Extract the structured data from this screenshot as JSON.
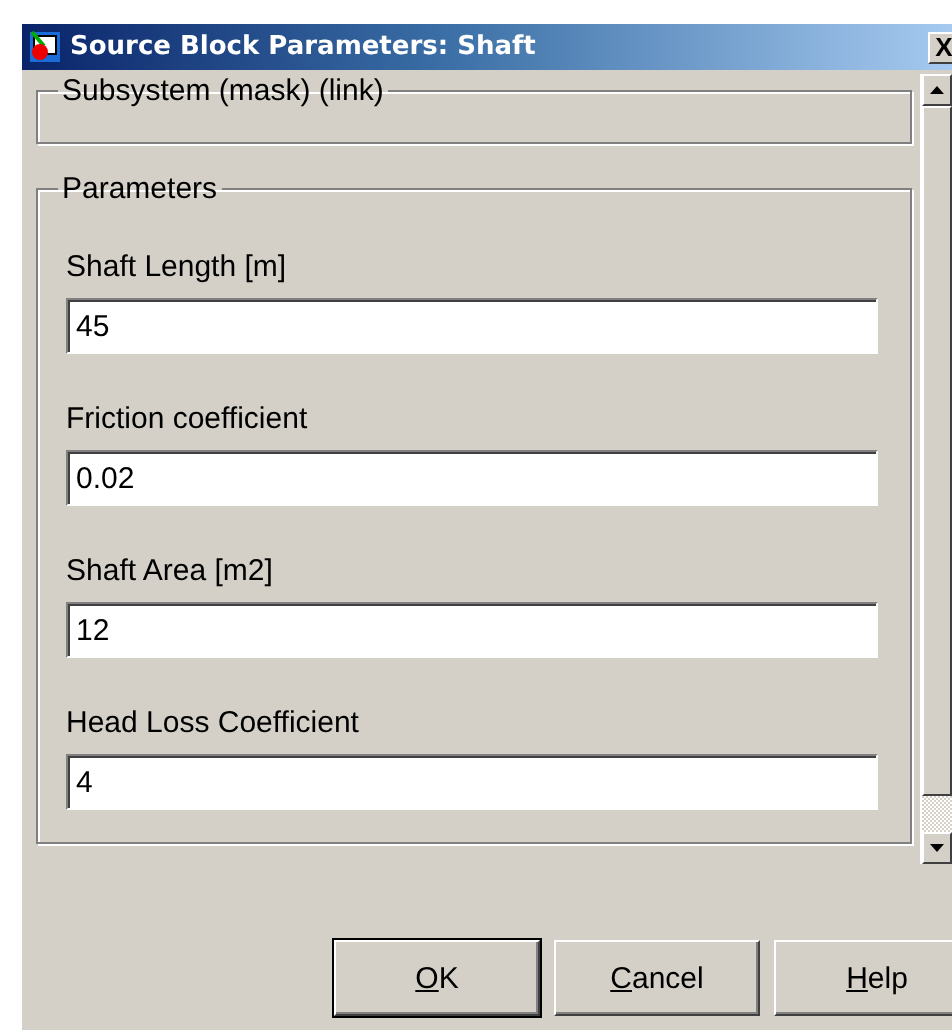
{
  "window": {
    "title": "Source Block Parameters: Shaft",
    "close": "X"
  },
  "description_group": {
    "title": "Subsystem (mask) (link)"
  },
  "parameters_group": {
    "title": "Parameters",
    "fields": [
      {
        "label": "Shaft Length [m]",
        "value": "45"
      },
      {
        "label": "Friction coefficient",
        "value": "0.02"
      },
      {
        "label": "Shaft Area [m2]",
        "value": "12"
      },
      {
        "label": "Head Loss Coefficient",
        "value": "4"
      }
    ]
  },
  "buttons": [
    {
      "label": "OK",
      "default": true
    },
    {
      "label": "Cancel",
      "default": false
    },
    {
      "label": "Help",
      "default": false
    }
  ]
}
